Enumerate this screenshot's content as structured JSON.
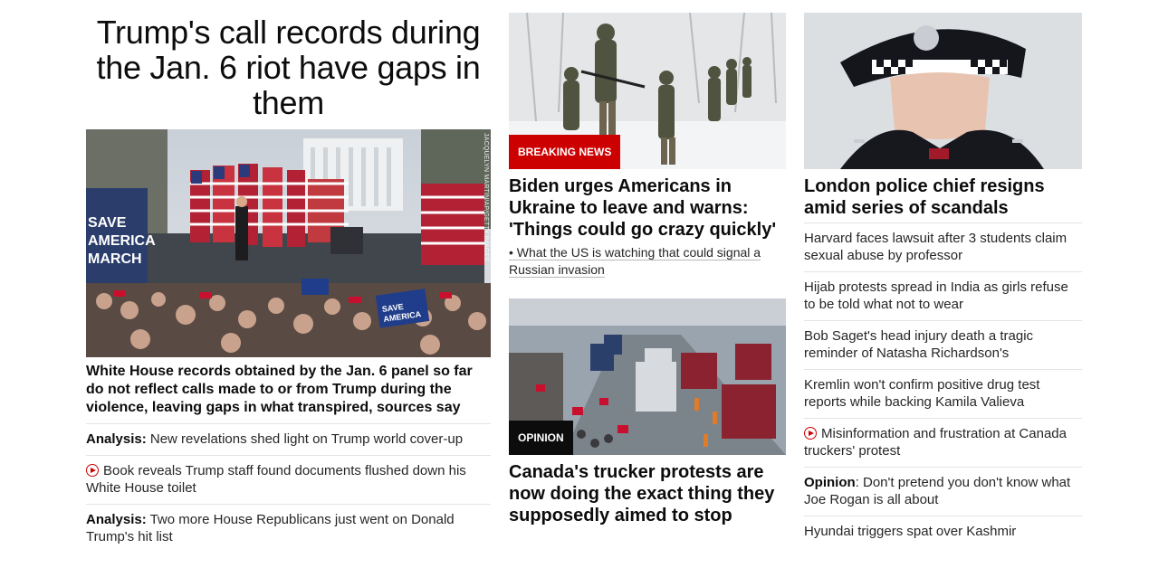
{
  "col1": {
    "headline": "Trump's call records during the Jan. 6 riot have gaps in them",
    "image_credit": "JACQUELYN MARTIN/AP/GETTY IMAGES",
    "sign_text": "SAVE AMERICA MARCH",
    "placard_text": "SAVE AMERICA",
    "lead": "White House records obtained by the Jan. 6 panel so far do not reflect calls made to or from Trump during the violence, leaving gaps in what transpired, sources say",
    "items": [
      {
        "prefix": "Analysis:",
        "text": " New revelations shed light on Trump world cover-up"
      },
      {
        "icon": "play-icon",
        "text": "Book reveals Trump staff found documents flushed down his White House toilet"
      },
      {
        "prefix": "Analysis:",
        "text": " Two more House Republicans just went on Donald Trump's hit list"
      }
    ]
  },
  "col2": {
    "story1": {
      "badge": "BREAKING NEWS",
      "headline": "Biden urges Americans in Ukraine to leave and warns: 'Things could go crazy quickly'",
      "sub": "What the US is watching that could signal a Russian invasion"
    },
    "story2": {
      "badge": "OPINION",
      "headline": "Canada's trucker protests are now doing the exact thing they supposedly aimed to stop"
    }
  },
  "col3": {
    "headline": "London police chief resigns amid series of scandals",
    "items": [
      {
        "text": "Harvard faces lawsuit after 3 students claim sexual abuse by professor"
      },
      {
        "text": "Hijab protests spread in India as girls refuse to be told what not to wear"
      },
      {
        "text": "Bob Saget's head injury death a tragic reminder of Natasha Richardson's"
      },
      {
        "text": "Kremlin won't confirm positive drug test reports while backing Kamila Valieva"
      },
      {
        "icon": "play-icon",
        "text": "Misinformation and frustration at Canada truckers' protest"
      },
      {
        "prefix": "Opinion",
        "text": ": Don't pretend you don't know what Joe Rogan is all about"
      },
      {
        "text": "Hyundai triggers spat over Kashmir"
      }
    ]
  },
  "colors": {
    "accent_red": "#cc0000",
    "dark_badge": "#0c0c0c",
    "divider": "#e4e4e4"
  }
}
